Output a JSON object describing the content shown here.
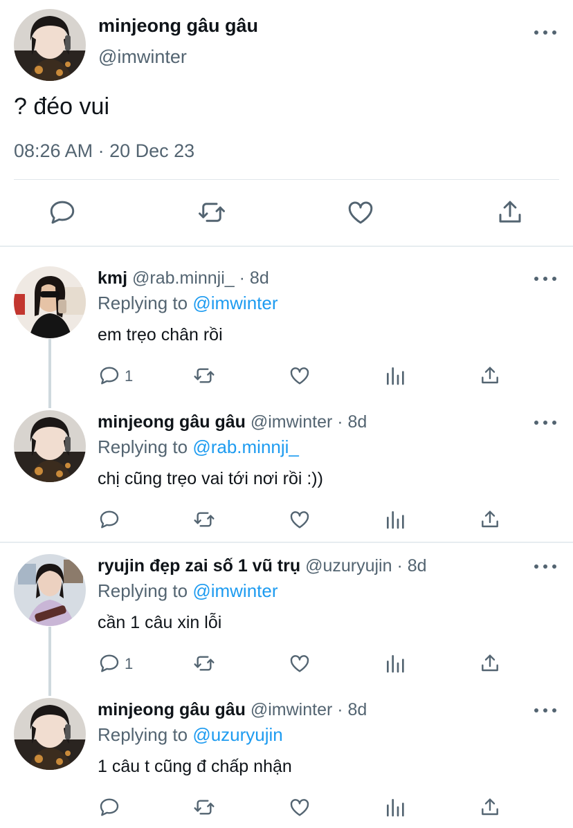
{
  "main_tweet": {
    "display_name": "minjeong gâu gâu",
    "handle": "@imwinter",
    "text": "? đéo vui",
    "timestamp": "08:26 AM · 20 Dec 23"
  },
  "replies": [
    {
      "display_name": "kmj",
      "handle_age": " @rab.minnji_ · 8d",
      "replying_prefix": "Replying to ",
      "replying_to": "@imwinter",
      "text": "em trẹo chân rồi",
      "reply_count": "1",
      "avatar_color": "#d9c3b0"
    },
    {
      "display_name": "minjeong gâu gâu",
      "handle_age": " @imwinter · 8d",
      "replying_prefix": "Replying to ",
      "replying_to": "@rab.minnji_",
      "text": "chị cũng trẹo vai tới nơi rồi :))",
      "reply_count": "",
      "avatar_color": "#c9c2b8"
    },
    {
      "display_name": "ryujin đẹp zai số 1 vũ trụ",
      "handle_age": " @uzuryujin · 8d",
      "replying_prefix": "Replying to ",
      "replying_to": "@imwinter",
      "text": "cần 1 câu xin lỗi",
      "reply_count": "1",
      "avatar_color": "#b9c4cf"
    },
    {
      "display_name": "minjeong gâu gâu",
      "handle_age": " @imwinter · 8d",
      "replying_prefix": "Replying to ",
      "replying_to": "@uzuryujin",
      "text": "1 câu t cũng đ chấp nhận",
      "reply_count": "",
      "avatar_color": "#c9c2b8"
    }
  ],
  "icons": {
    "reply": "reply-icon",
    "retweet": "retweet-icon",
    "like": "heart-icon",
    "views": "analytics-icon",
    "share": "share-icon",
    "more": "more-icon"
  },
  "colors": {
    "text": "#0f1419",
    "secondary": "#536471",
    "link": "#1d9bf0",
    "divider": "#e1e6ea"
  }
}
